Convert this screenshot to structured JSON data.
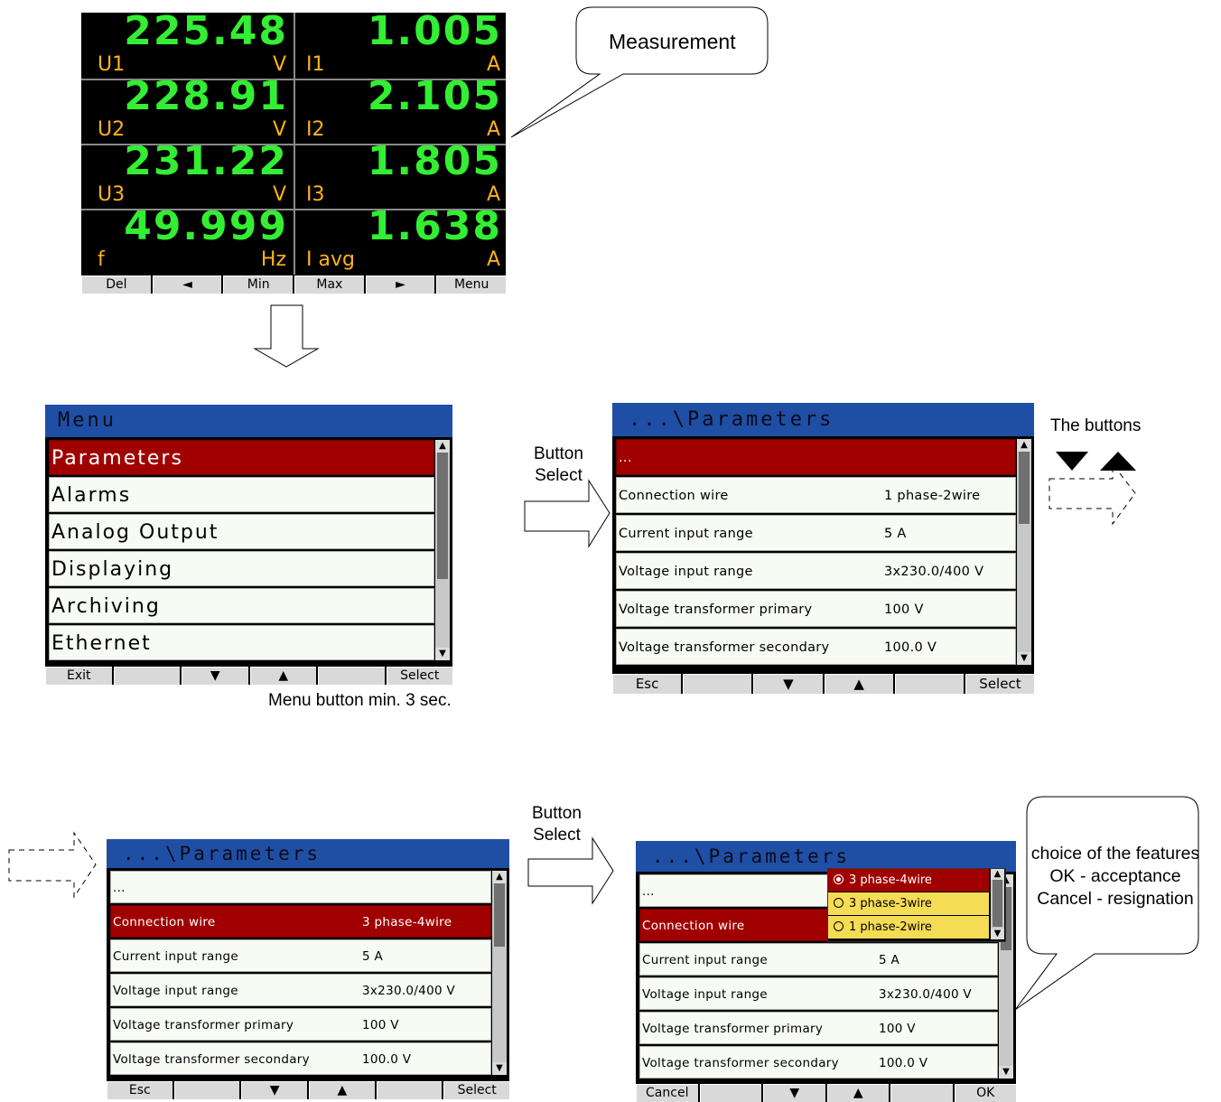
{
  "measurement": {
    "cells": [
      {
        "label": "U1",
        "value": "225.48",
        "unit": "V"
      },
      {
        "label": "I1",
        "value": "1.005",
        "unit": "A"
      },
      {
        "label": "U2",
        "value": "228.91",
        "unit": "V"
      },
      {
        "label": "I2",
        "value": "2.105",
        "unit": "A"
      },
      {
        "label": "U3",
        "value": "231.22",
        "unit": "V"
      },
      {
        "label": "I3",
        "value": "1.805",
        "unit": "A"
      },
      {
        "label": "f",
        "value": "49.999",
        "unit": "Hz"
      },
      {
        "label": "I avg",
        "value": "1.638",
        "unit": "A"
      }
    ],
    "buttons": [
      "Del",
      "◄",
      "Min",
      "Max",
      "►",
      "Menu"
    ]
  },
  "menu_screen": {
    "title": "Menu",
    "items": [
      "Parameters",
      "Alarms",
      "Analog Output",
      "Displaying",
      "Archiving",
      "Ethernet"
    ],
    "buttons": [
      "Exit",
      "",
      "▼",
      "▲",
      "",
      "Select"
    ]
  },
  "params_screen_1": {
    "title": "...\\Parameters",
    "rows": [
      {
        "name": "...",
        "value": ""
      },
      {
        "name": "Connection wire",
        "value": "1 phase-2wire"
      },
      {
        "name": "Current input range",
        "value": "5 A"
      },
      {
        "name": "Voltage input range",
        "value": "3x230.0/400 V"
      },
      {
        "name": "Voltage transformer primary",
        "value": "100 V"
      },
      {
        "name": "Voltage transformer secondary",
        "value": "100.0 V"
      }
    ],
    "buttons": [
      "Esc",
      "",
      "▼",
      "▲",
      "",
      "Select"
    ]
  },
  "params_screen_2": {
    "title": "...\\Parameters",
    "rows": [
      {
        "name": "...",
        "value": ""
      },
      {
        "name": "Connection wire",
        "value": "3 phase-4wire"
      },
      {
        "name": "Current input range",
        "value": "5 A"
      },
      {
        "name": "Voltage input range",
        "value": "3x230.0/400 V"
      },
      {
        "name": "Voltage transformer primary",
        "value": "100 V"
      },
      {
        "name": "Voltage transformer secondary",
        "value": "100.0 V"
      }
    ],
    "buttons": [
      "Esc",
      "",
      "▼",
      "▲",
      "",
      "Select"
    ]
  },
  "params_screen_3": {
    "title": "...\\Parameters",
    "rows": [
      {
        "name": "...",
        "value": ""
      },
      {
        "name": "Connection wire",
        "value": ""
      },
      {
        "name": "Current input range",
        "value": "5 A"
      },
      {
        "name": "Voltage input range",
        "value": "3x230.0/400 V"
      },
      {
        "name": "Voltage transformer primary",
        "value": "100 V"
      },
      {
        "name": "Voltage transformer secondary",
        "value": "100.0 V"
      }
    ],
    "dropdown": {
      "options": [
        "3 phase-4wire",
        "3 phase-3wire",
        "1 phase-2wire"
      ],
      "selected": 0
    },
    "buttons": [
      "Cancel",
      "",
      "▼",
      "▲",
      "",
      "OK"
    ]
  },
  "annotations": {
    "measurement": "Measurement",
    "button_select_1": [
      "Button",
      "Select"
    ],
    "button_select_2": [
      "Button",
      "Select"
    ],
    "menu_hold": "Menu button min. 3 sec.",
    "the_buttons": "The buttons",
    "choice": [
      "choice of the features",
      "OK - acceptance",
      "Cancel - resignation"
    ]
  },
  "colors": {
    "value_green": "#33ee33",
    "label_orange": "#ffb21a",
    "title_blue": "#1f4fa5",
    "selected_red": "#a00000",
    "dropdown_yellow": "#f5dc55"
  }
}
